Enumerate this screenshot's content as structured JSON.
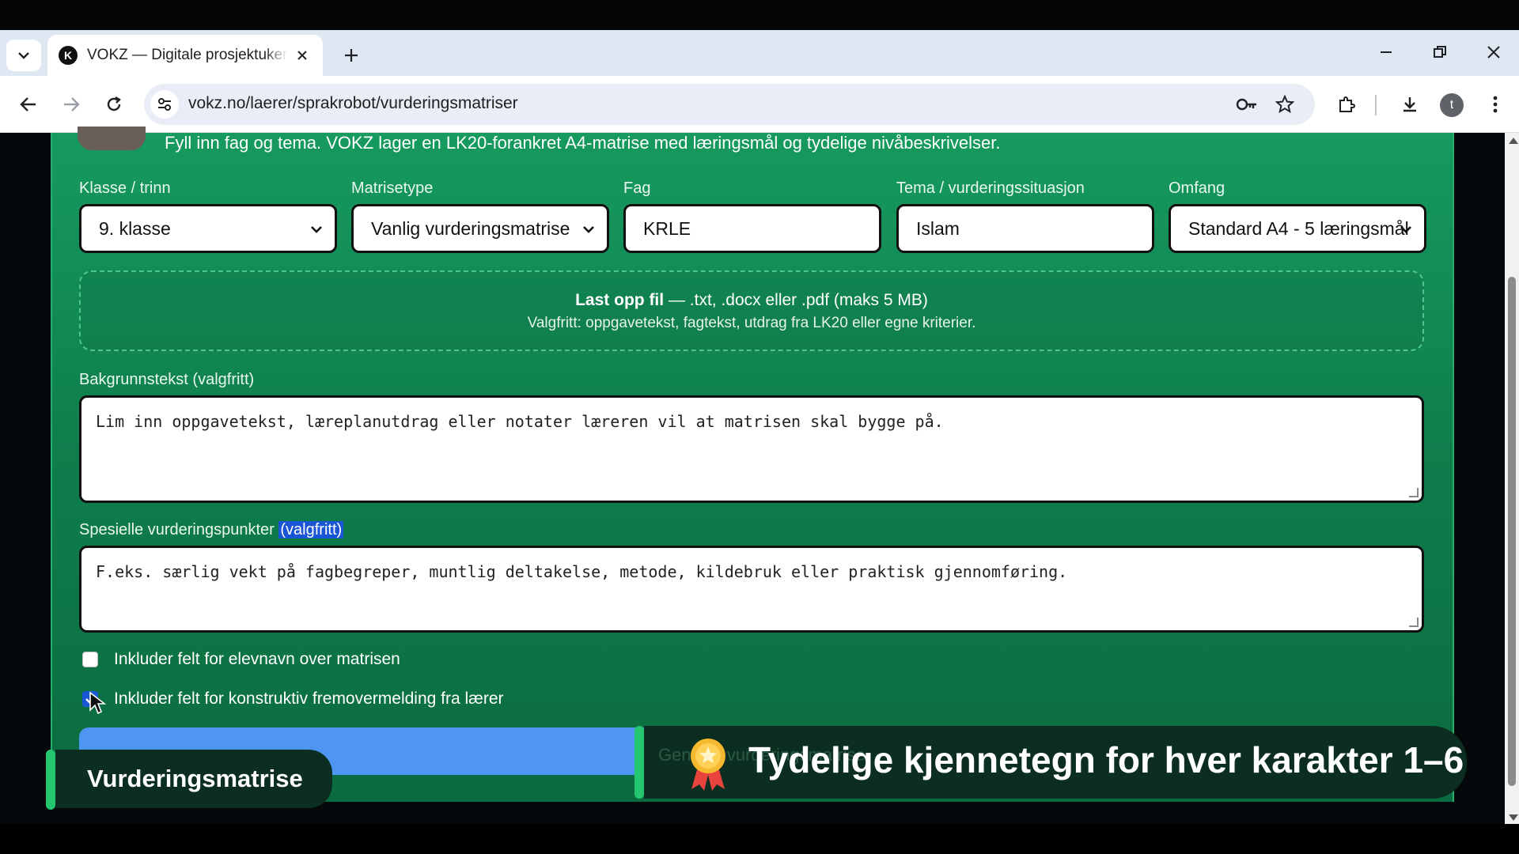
{
  "browser": {
    "tab_title": "VOKZ — Digitale prosjektuker og vurdering",
    "favicon_letter": "K",
    "url": "vokz.no/laerer/sprakrobot/vurderingsmatriser",
    "profile_initial": "t"
  },
  "page": {
    "intro": "Fyll inn fag og tema. VOKZ lager en LK20-forankret A4-matrise med læringsmål og tydelige nivåbeskrivelser.",
    "fields": {
      "klasse_label": "Klasse / trinn",
      "klasse_value": "9. klasse",
      "matrisetype_label": "Matrisetype",
      "matrisetype_value": "Vanlig vurderingsmatrise",
      "fag_label": "Fag",
      "fag_value": "KRLE",
      "tema_label": "Tema / vurderingssituasjon",
      "tema_value": "Islam",
      "omfang_label": "Omfang",
      "omfang_value": "Standard A4 - 5 læringsmål"
    },
    "upload": {
      "title_bold": "Last opp fil",
      "title_rest": " — .txt, .docx eller .pdf (maks 5 MB)",
      "subtitle": "Valgfritt: oppgavetekst, fagtekst, utdrag fra LK20 eller egne kriterier."
    },
    "background": {
      "label": "Bakgrunnstekst (valgfritt)",
      "placeholder": "Lim inn oppgavetekst, læreplanutdrag eller notater læreren vil at matrisen skal bygge på."
    },
    "special": {
      "label_main": "Spesielle vurderingspunkter ",
      "label_highlight": "(valgfritt)",
      "placeholder": "F.eks. særlig vekt på fagbegreper, muntlig deltakelse, metode, kildebruk eller praktisk gjennomføring."
    },
    "checkboxes": {
      "student_name_label": "Inkluder felt for elevnavn over matrisen",
      "student_name_checked": false,
      "feedback_label": "Inkluder felt for konstruktiv fremovermelding fra lærer",
      "feedback_checked": true
    },
    "generate_partial": "Generer vurderingsmatrise"
  },
  "overlay": {
    "left_caption": "Vurderingsmatrise",
    "right_caption": "Tydelige kjennetegn for hver karakter 1–6",
    "accent": "#24c66f"
  }
}
